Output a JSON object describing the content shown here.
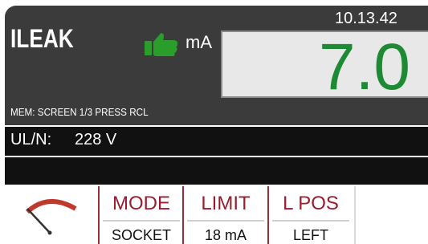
{
  "header": {
    "title": "ILEAK",
    "unit": "mA",
    "time": "10.13.42",
    "status_icon": "thumbs-up-icon"
  },
  "result": {
    "value": "7.0",
    "color": "#1e8a33"
  },
  "memory_line": "MEM: SCREEN 1/3 PRESS RCL",
  "voltage": {
    "label": "UL/N:",
    "value": "228 V"
  },
  "gauge_icon": "needle-gauge-icon",
  "tabs": [
    {
      "label": "MODE",
      "value": "SOCKET"
    },
    {
      "label": "LIMIT",
      "value": "18 mA"
    },
    {
      "label": "L POS",
      "value": "LEFT"
    }
  ],
  "colors": {
    "panel": "#3b3b3b",
    "bar": "#111111",
    "accent": "#9b1b2f",
    "ok_green": "#2a9d2a"
  }
}
